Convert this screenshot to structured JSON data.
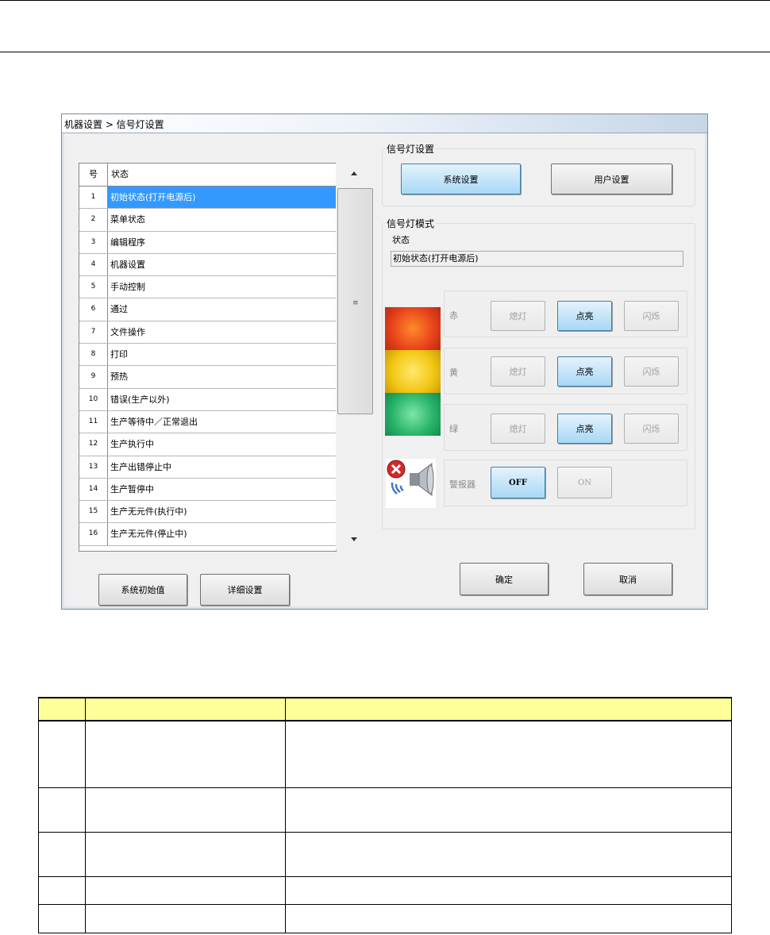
{
  "window": {
    "title": "机器设置 > 信号灯设置"
  },
  "status_list": {
    "headers": {
      "no": "号",
      "status": "状态"
    },
    "rows": [
      {
        "no": "1",
        "label": "初始状态(打开电源后)"
      },
      {
        "no": "2",
        "label": "菜单状态"
      },
      {
        "no": "3",
        "label": "编辑程序"
      },
      {
        "no": "4",
        "label": "机器设置"
      },
      {
        "no": "5",
        "label": "手动控制"
      },
      {
        "no": "6",
        "label": "通过"
      },
      {
        "no": "7",
        "label": "文件操作"
      },
      {
        "no": "8",
        "label": "打印"
      },
      {
        "no": "9",
        "label": "预热"
      },
      {
        "no": "10",
        "label": "错误(生产以外)"
      },
      {
        "no": "11",
        "label": "生产等待中／正常退出"
      },
      {
        "no": "12",
        "label": "生产执行中"
      },
      {
        "no": "13",
        "label": "生产出错停止中"
      },
      {
        "no": "14",
        "label": "生产暂停中"
      },
      {
        "no": "15",
        "label": "生产无元件(执行中)"
      },
      {
        "no": "16",
        "label": "生产无元件(停止中)"
      }
    ],
    "selected": "1",
    "scroll_grip": "≡"
  },
  "signal_settings": {
    "title": "信号灯设置",
    "system_button": "系统设置",
    "user_button": "用户设置"
  },
  "signal_mode": {
    "title": "信号灯模式",
    "status_label": "状态",
    "status_value": "初始状态(打开电源后)",
    "lamps": [
      {
        "name": "赤",
        "off": "熄灯",
        "on": "点亮",
        "blink": "闪烁",
        "selected": "点亮"
      },
      {
        "name": "黄",
        "off": "熄灯",
        "on": "点亮",
        "blink": "闪烁",
        "selected": "点亮"
      },
      {
        "name": "绿",
        "off": "熄灯",
        "on": "点亮",
        "blink": "闪烁",
        "selected": "点亮"
      }
    ],
    "buzzer": {
      "label": "警报器",
      "off": "OFF",
      "on": "ON",
      "selected": "OFF"
    }
  },
  "footer": {
    "system_default": "系统初始值",
    "detail_settings": "详细设置",
    "ok": "确定",
    "cancel": "取消"
  },
  "colors": {
    "selection": "#3399ff",
    "red_lamp": "#e8431c",
    "yellow_lamp": "#f2c615",
    "green_lamp": "#27b36a",
    "table_header": "#ffff99"
  }
}
